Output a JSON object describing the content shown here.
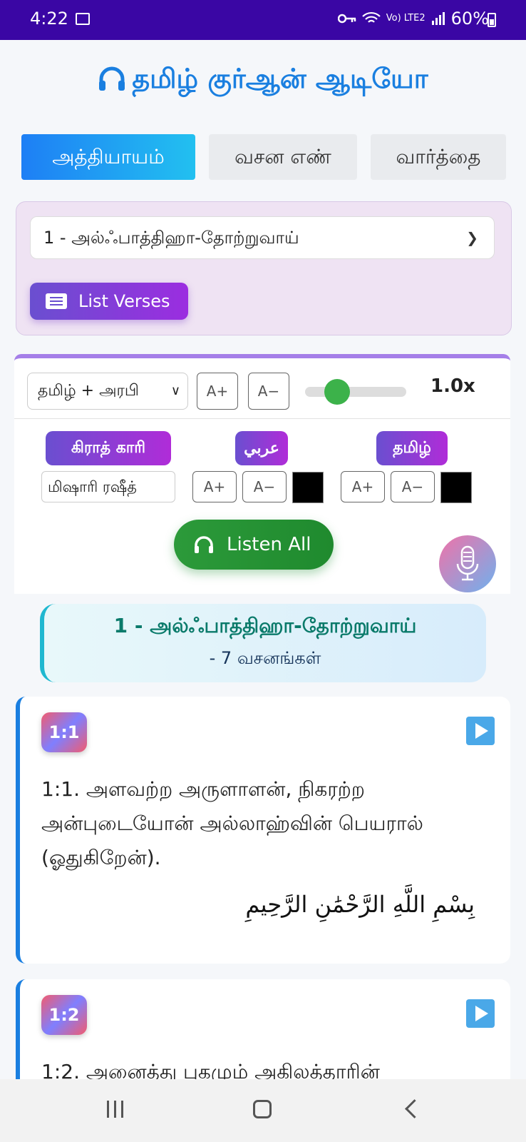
{
  "status": {
    "time": "4:22",
    "network": "Vo) LTE2",
    "battery": "60%"
  },
  "app": {
    "title": "தமிழ் குர்ஆன் ஆடியோ"
  },
  "tabs": [
    {
      "label": "அத்தியாயம்",
      "active": true
    },
    {
      "label": "வசன எண்",
      "active": false
    },
    {
      "label": "வார்த்தை",
      "active": false
    }
  ],
  "chapter_select": {
    "value": "1 - அல்ஃபாத்திஹா-தோற்றுவாய்"
  },
  "list_verses_button": "List Verses",
  "controls": {
    "language_select": "தமிழ் + அரபி",
    "font_increase": "A+",
    "font_decrease": "A−",
    "speed": "1.0x",
    "speed_level": 0.25
  },
  "audio_settings": {
    "reciter_label": "கிராத் காரி",
    "reciter_value": "மிஷாரி ரஷீத்",
    "arabic_label": "عربي",
    "tamil_label": "தமிழ்",
    "arabic_color": "#000000",
    "tamil_color": "#000000"
  },
  "listen_all_button": "Listen All",
  "surah_header": {
    "title": "1 - அல்ஃபாத்திஹா-தோற்றுவாய்",
    "subtitle": "- 7 வசனங்கள்"
  },
  "verses": [
    {
      "badge": "1:1",
      "tamil": "1:1. அளவற்ற அருளாளன், நிகரற்ற அன்புடையோன் அல்லாஹ்வின் பெயரால் (ஓதுகிறேன்).",
      "arabic": "بِسْمِ اللَّهِ الرَّحْمَٰنِ الرَّحِيمِ"
    },
    {
      "badge": "1:2",
      "tamil": "1:2. அனைத்து புகழும் அகிலத்தாரின்"
    }
  ],
  "colors": {
    "status_bar": "#3a06a4",
    "title": "#1a7fe0",
    "listen_all": "#2c9a3a",
    "verse_accent": "#1a7fe0"
  }
}
